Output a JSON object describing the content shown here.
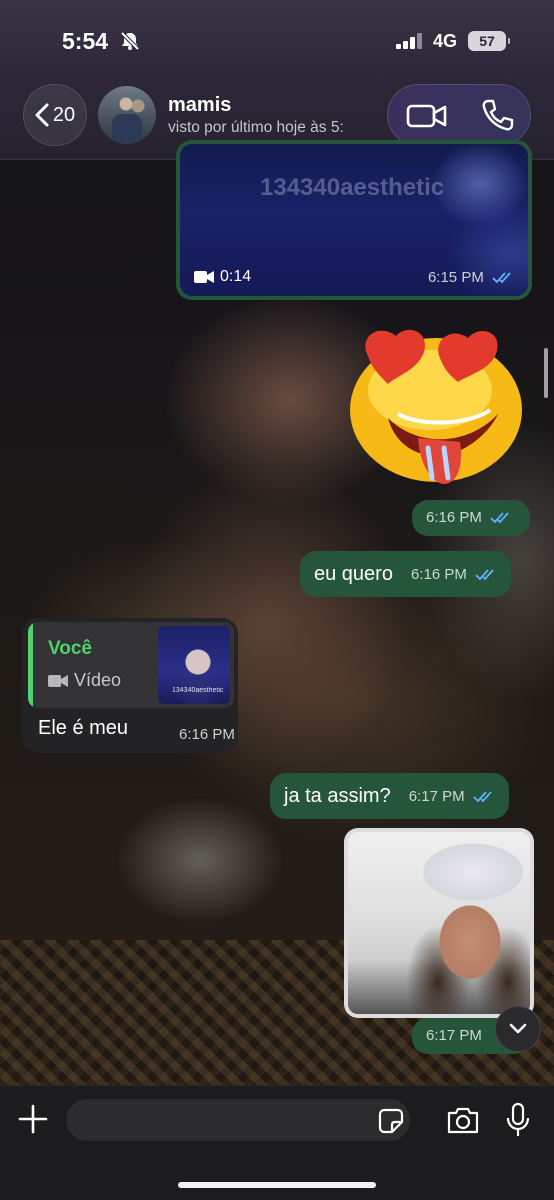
{
  "status_bar": {
    "time": "5:54",
    "network": "4G",
    "battery": "57"
  },
  "header": {
    "back_count": "20",
    "contact_name": "mamis",
    "contact_status": "visto por último hoje às 5:"
  },
  "messages": {
    "video": {
      "watermark": "134340aesthetic",
      "duration": "0:14",
      "time": "6:15 PM"
    },
    "sticker": {
      "time": "6:16 PM"
    },
    "eu_quero": {
      "text": "eu quero",
      "time": "6:16 PM"
    },
    "reply": {
      "quoted_author": "Você",
      "quoted_type": "Vídeo",
      "thumb_text": "134340aesthetic",
      "text": "Ele é meu",
      "time": "6:16 PM"
    },
    "ja_ta_assim": {
      "text": "ja ta assim?",
      "time": "6:17 PM"
    },
    "image": {
      "time": "6:17 PM"
    }
  },
  "composer": {
    "placeholder": ""
  },
  "colors": {
    "outgoing_bubble": "#25553a",
    "incoming_bubble": "#232325",
    "accent_green": "#4fd26b",
    "read_ticks": "#5fb2ff"
  }
}
